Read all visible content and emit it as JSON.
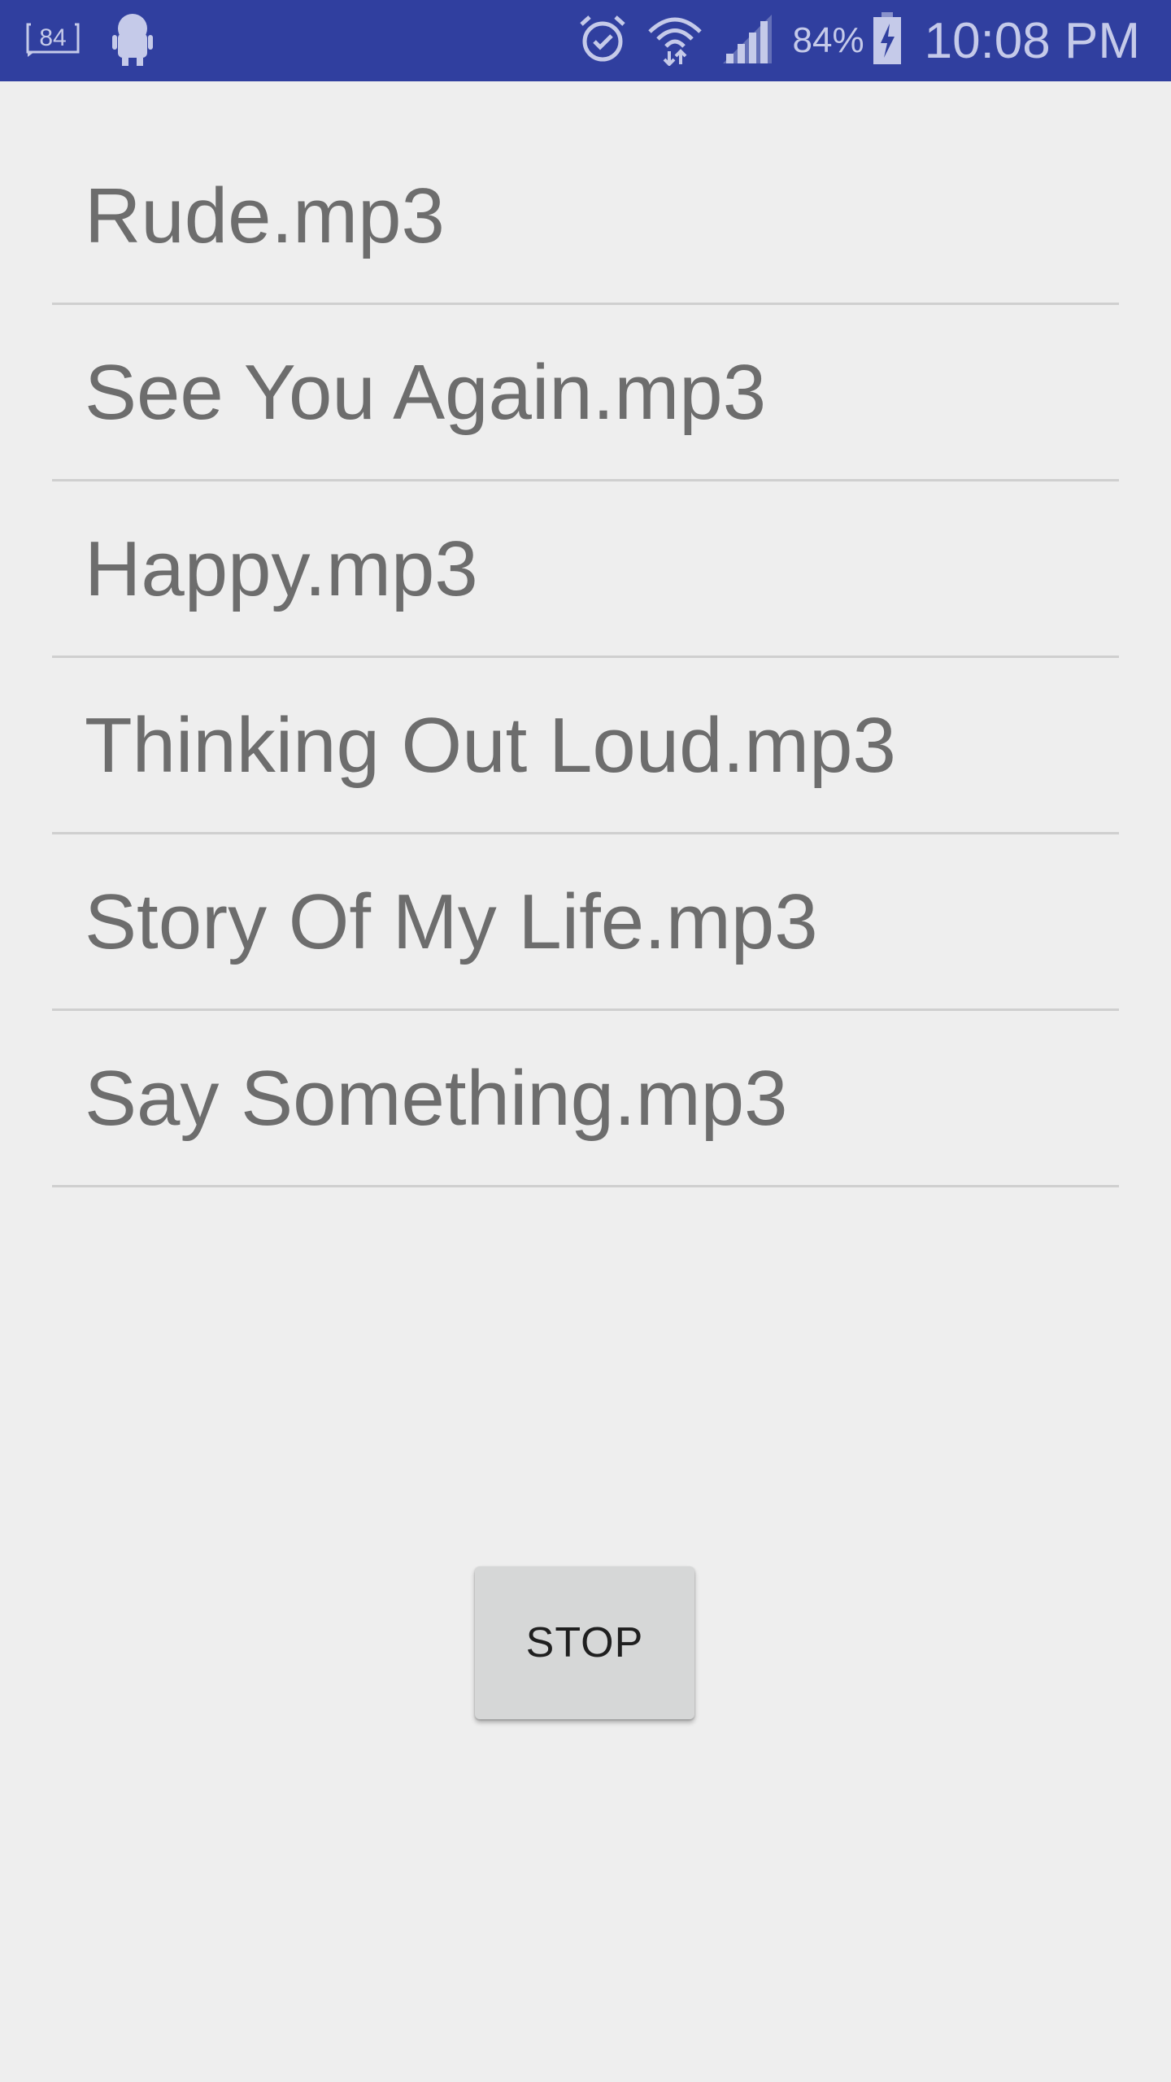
{
  "status_bar": {
    "notification_count": "84",
    "battery_percent": "84%",
    "time": "10:08 PM",
    "icons": [
      "notification-count-icon",
      "android-debug-icon",
      "alarm-icon",
      "wifi-icon",
      "signal-icon",
      "battery-charging-icon"
    ],
    "background_color": "#303f9f"
  },
  "songs": [
    {
      "label": "Rude.mp3"
    },
    {
      "label": "See You Again.mp3"
    },
    {
      "label": "Happy.mp3"
    },
    {
      "label": "Thinking Out Loud.mp3"
    },
    {
      "label": "Story Of My Life.mp3"
    },
    {
      "label": "Say Something.mp3"
    }
  ],
  "controls": {
    "stop_label": "STOP"
  }
}
